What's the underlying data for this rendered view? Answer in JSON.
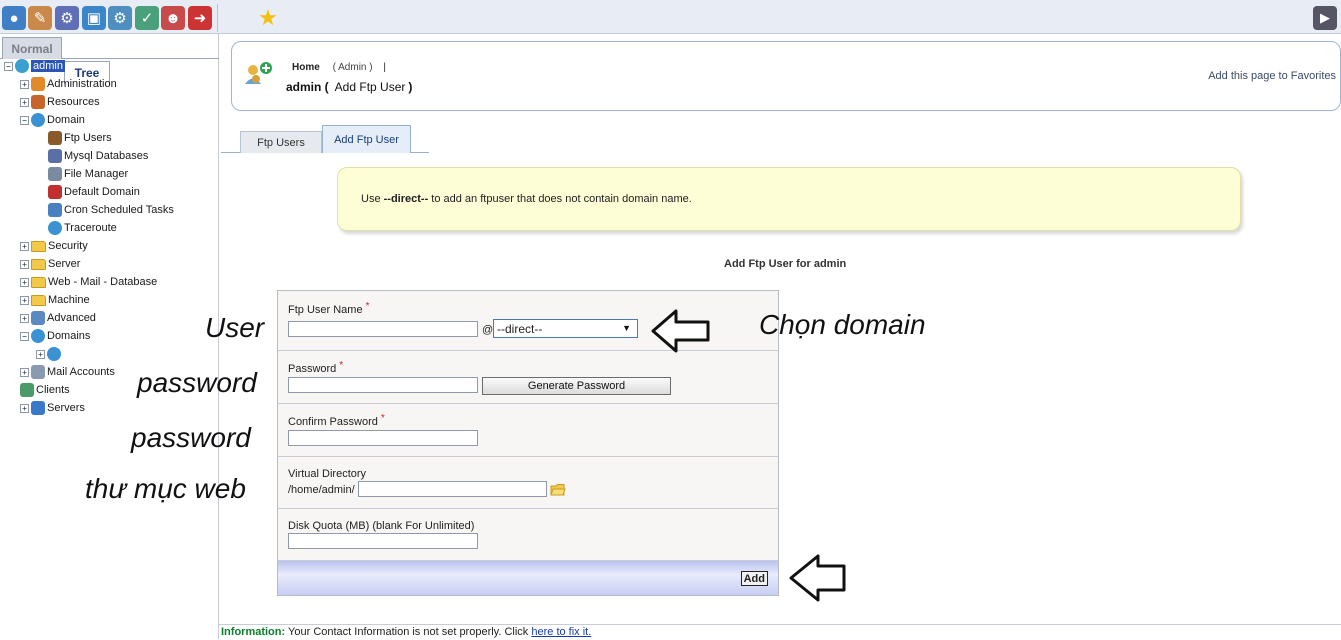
{
  "toolbar": {
    "buttons": [
      {
        "icon": "users-icon",
        "color": "#3f7fc6"
      },
      {
        "icon": "notes-icon",
        "color": "#c8894a"
      },
      {
        "icon": "gears-icon",
        "color": "#5e6fb8"
      },
      {
        "icon": "package-icon",
        "color": "#3b86c8"
      },
      {
        "icon": "user-gear-icon",
        "color": "#4f8fc0"
      },
      {
        "icon": "checklist-icon",
        "color": "#4aa07a"
      },
      {
        "icon": "support-agent-icon",
        "color": "#c84a4a"
      },
      {
        "icon": "exit-icon",
        "color": "#cc3333"
      }
    ],
    "favorite_icon": "star-icon",
    "right_icon": "speaker-icon"
  },
  "sidebar": {
    "tabs": [
      {
        "label": "Normal"
      },
      {
        "label": "Tree"
      }
    ],
    "tree": [
      {
        "label": "admin",
        "level": 0,
        "expander": "−",
        "icon": "globe-user",
        "selected": true
      },
      {
        "label": "Administration",
        "level": 1,
        "expander": "+",
        "icon": "admin"
      },
      {
        "label": "Resources",
        "level": 1,
        "expander": "+",
        "icon": "resources"
      },
      {
        "label": "Domain",
        "level": 1,
        "expander": "−",
        "icon": "globe"
      },
      {
        "label": "Ftp Users",
        "level": 2,
        "icon": "ftp"
      },
      {
        "label": "Mysql Databases",
        "level": 2,
        "icon": "mysql"
      },
      {
        "label": "File Manager",
        "level": 2,
        "icon": "file"
      },
      {
        "label": "Default Domain",
        "level": 2,
        "icon": "pin"
      },
      {
        "label": "Cron Scheduled Tasks",
        "level": 2,
        "icon": "cron"
      },
      {
        "label": "Traceroute",
        "level": 2,
        "icon": "globe"
      },
      {
        "label": "Security",
        "level": 1,
        "expander": "+",
        "icon": "folder"
      },
      {
        "label": "Server",
        "level": 1,
        "expander": "+",
        "icon": "folder"
      },
      {
        "label": "Web - Mail - Database",
        "level": 1,
        "expander": "+",
        "icon": "folder"
      },
      {
        "label": "Machine",
        "level": 1,
        "expander": "+",
        "icon": "folder"
      },
      {
        "label": "Advanced",
        "level": 1,
        "expander": "+",
        "icon": "advanced"
      },
      {
        "label": "Domains",
        "level": 1,
        "expander": "−",
        "icon": "globe"
      },
      {
        "label": "",
        "level": 2,
        "expander": "+",
        "icon": "globe"
      },
      {
        "label": "Mail Accounts",
        "level": 1,
        "expander": "+",
        "icon": "mail"
      },
      {
        "label": "Clients",
        "level": 1,
        "icon": "users"
      },
      {
        "label": "Servers",
        "level": 1,
        "expander": "+",
        "icon": "server"
      }
    ]
  },
  "header": {
    "breadcrumb_home": "Home",
    "breadcrumb_admin": "( Admin )",
    "breadcrumb_sep": "|",
    "title_user": "admin (",
    "title_page": "Add Ftp User",
    "title_close": ")",
    "favorites": "Add this page to Favorites"
  },
  "tabs": [
    {
      "label": "Ftp Users"
    },
    {
      "label": "Add Ftp User"
    }
  ],
  "notice": {
    "prefix": "Use",
    "keyword": "--direct--",
    "suffix": "to add an ftpuser that does not contain domain name."
  },
  "form": {
    "title": "Add Ftp User for admin",
    "ftp_user_label": "Ftp User Name",
    "required_mark": "*",
    "at_sign": "@",
    "domain_selected": "--direct--",
    "password_label": "Password",
    "generate_label": "Generate Password",
    "confirm_label": "Confirm Password",
    "vdir_label": "Virtual Directory",
    "vdir_prefix": "/home/admin/",
    "quota_label": "Disk Quota (MB) (blank For Unlimited)",
    "add_label": "Add"
  },
  "annotations": {
    "user": "User",
    "password": "password",
    "confirm": "password",
    "webdir": "thư mục web",
    "domain": "Chọn domain"
  },
  "infobar": {
    "label": "Information:",
    "text": "Your Contact Information is not set properly. Click",
    "link": "here to fix it."
  }
}
